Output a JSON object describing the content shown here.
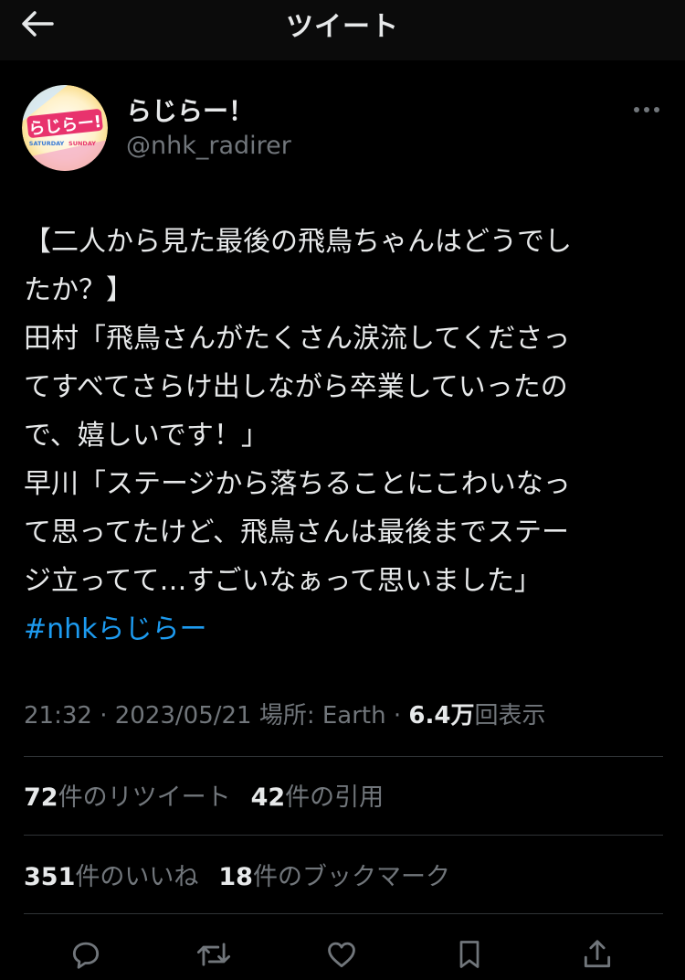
{
  "header": {
    "title": "ツイート"
  },
  "author": {
    "display_name": "らじらー！",
    "handle": "@nhk_radirer",
    "avatar_logo_text": "らじらー!",
    "avatar_sub_left": "SATURDAY",
    "avatar_sub_right": "SUNDAY"
  },
  "tweet": {
    "lines": [
      "【二人から見た最後の飛鳥ちゃんはどうでし",
      "たか？】",
      "田村「飛鳥さんがたくさん涙流してくださっ",
      "てすべてさらけ出しながら卒業していったの",
      "で、嬉しいです！」",
      "早川「ステージから落ちることにこわいなっ",
      "て思ってたけど、飛鳥さんは最後までステー",
      "ジ立ってて…すごいなぁって思いました」"
    ],
    "hashtag": "#nhkらじらー"
  },
  "meta": {
    "time": "21:32",
    "sep1": " · ",
    "date": "2023/05/21",
    "location": " 場所: Earth",
    "sep2": " · ",
    "views_count": "6.4万",
    "views_label": "回表示"
  },
  "stats": {
    "retweets_count": "72",
    "retweets_label": "件のリツイート",
    "quotes_count": "42",
    "quotes_label": "件の引用",
    "likes_count": "351",
    "likes_label": "件のいいね",
    "bookmarks_count": "18",
    "bookmarks_label": "件のブックマーク"
  },
  "colors": {
    "background": "#000000",
    "text": "#e7e9ea",
    "secondary": "#71767b",
    "link": "#1d9bf0",
    "divider": "#2f3336"
  },
  "icons": [
    "back-arrow-icon",
    "more-icon",
    "reply-icon",
    "retweet-icon",
    "like-icon",
    "bookmark-icon",
    "share-icon"
  ]
}
